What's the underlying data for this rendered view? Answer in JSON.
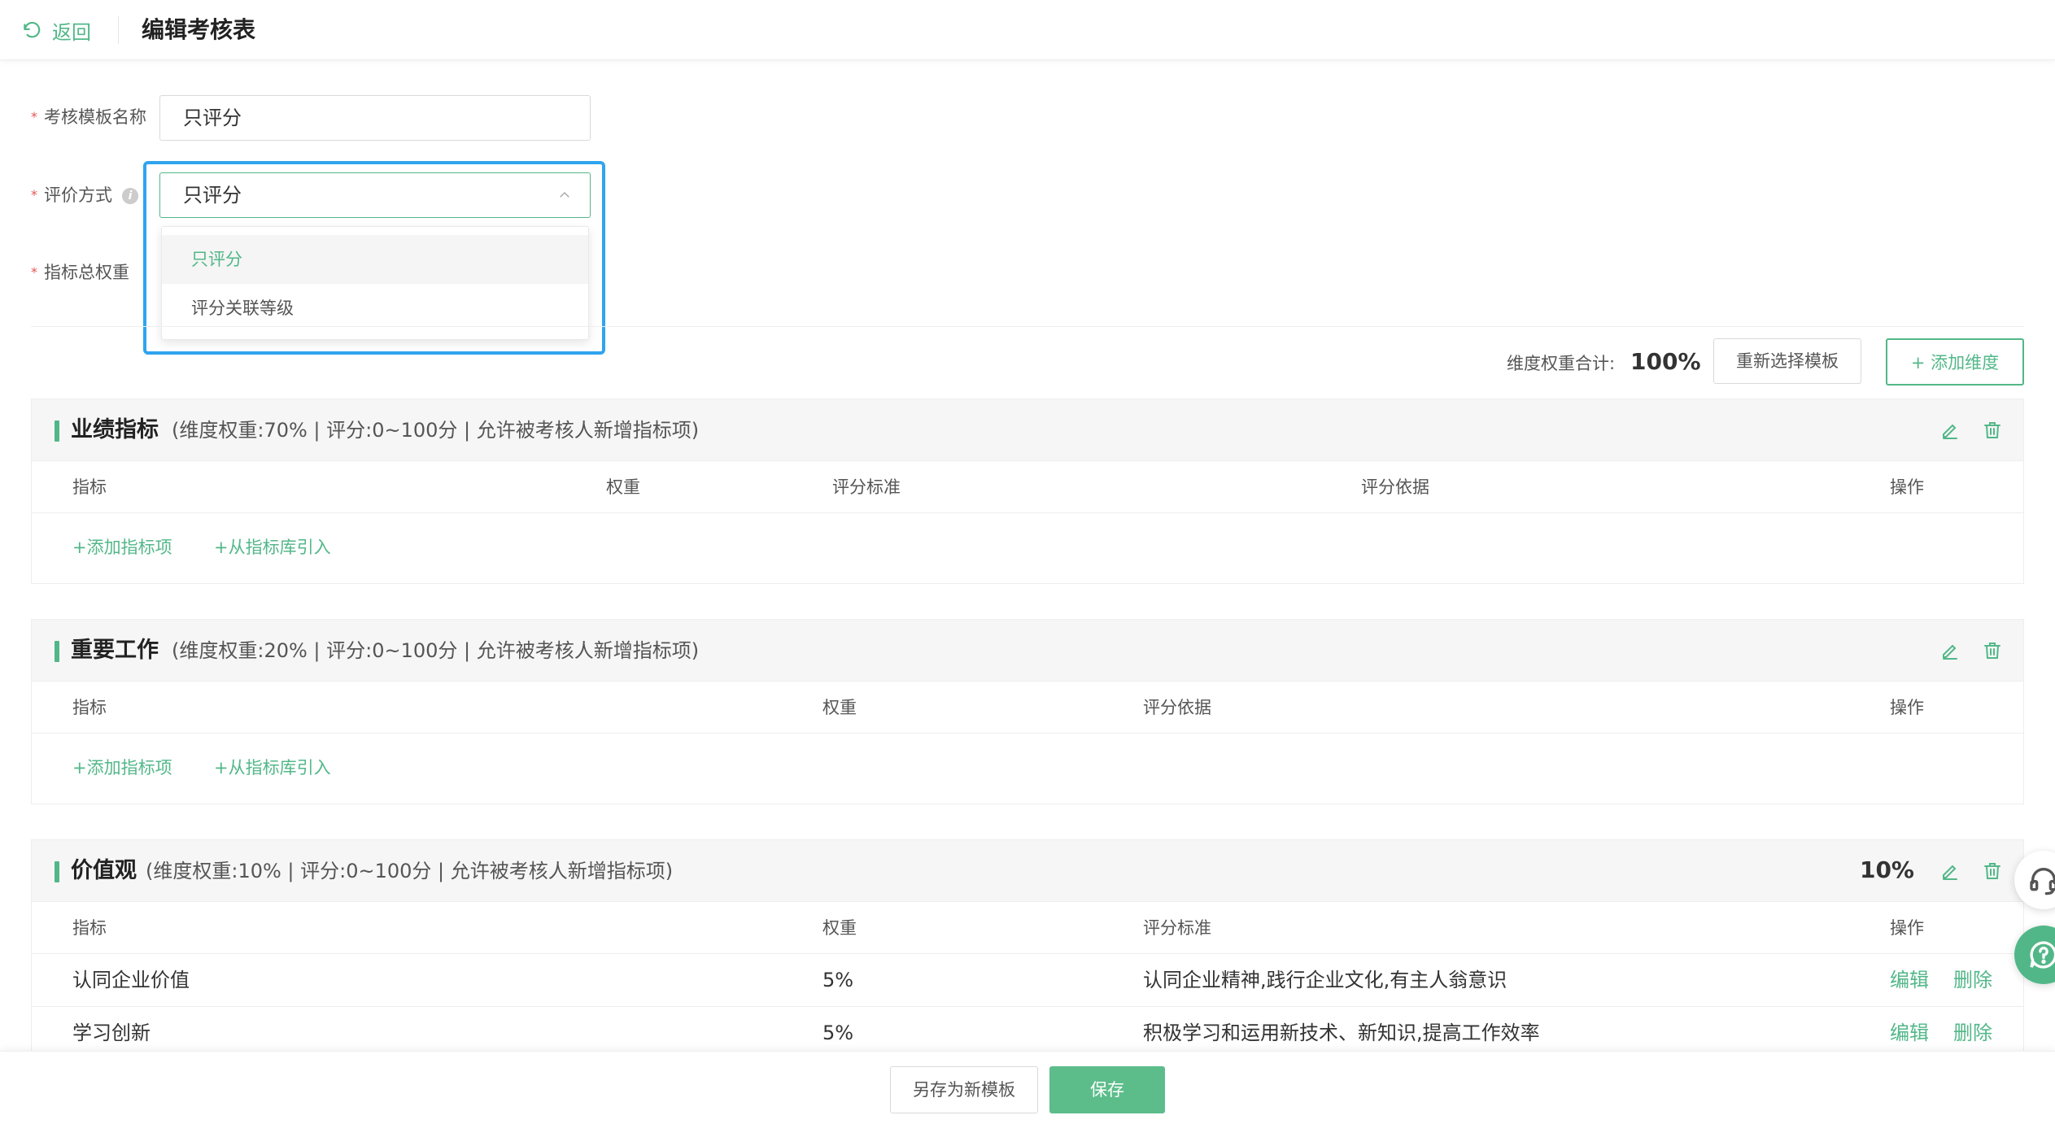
{
  "header": {
    "back_label": "返回",
    "title": "编辑考核表"
  },
  "form": {
    "template_name": {
      "label": "考核模板名称",
      "value": "只评分"
    },
    "eval_method": {
      "label": "评价方式",
      "value": "只评分",
      "options": [
        {
          "label": "只评分",
          "selected": true
        },
        {
          "label": "评分关联等级",
          "selected": false
        }
      ]
    },
    "total_weight": {
      "label": "指标总权重"
    }
  },
  "summary": {
    "label": "维度权重合计:",
    "value": "100%",
    "reselect_label": "重新选择模板",
    "add_dimension_label": "添加维度"
  },
  "sections": [
    {
      "title": "业绩指标",
      "meta": "(维度权重:70% | 评分:0~100分 | 允许被考核人新增指标项)",
      "columns": [
        "指标",
        "权重",
        "评分标准",
        "评分依据",
        "操作"
      ],
      "add_item_label": "添加指标项",
      "import_label": "从指标库引入"
    },
    {
      "title": "重要工作",
      "meta": "(维度权重:20% | 评分:0~100分 | 允许被考核人新增指标项)",
      "columns": [
        "指标",
        "权重",
        "评分依据",
        "操作"
      ],
      "add_item_label": "添加指标项",
      "import_label": "从指标库引入"
    },
    {
      "title": "价值观",
      "meta": "(维度权重:10% | 评分:0~100分 | 允许被考核人新增指标项)",
      "percent": "10%",
      "columns": [
        "指标",
        "权重",
        "评分标准",
        "操作"
      ],
      "rows": [
        {
          "name": "认同企业价值",
          "weight": "5%",
          "standard": "认同企业精神,践行企业文化,有主人翁意识",
          "edit": "编辑",
          "delete": "删除"
        },
        {
          "name": "学习创新",
          "weight": "5%",
          "standard": "积极学习和运用新技术、新知识,提高工作效率",
          "edit": "编辑",
          "delete": "删除"
        }
      ]
    }
  ],
  "footer": {
    "save_as_template_label": "另存为新模板",
    "save_label": "保存"
  },
  "colors": {
    "accent": "#52b788",
    "focus": "#2fa4ee",
    "required": "#e55555"
  }
}
